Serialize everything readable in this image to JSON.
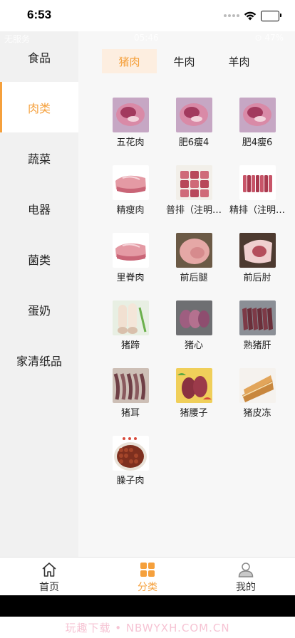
{
  "status_bar": {
    "time": "6:53"
  },
  "ghost_status": {
    "carrier": "无服务",
    "time": "05:46",
    "right": "⊙ 47%"
  },
  "colors": {
    "accent": "#f5a03c",
    "active_tab_bg": "#fdeee0",
    "sidebar_bg": "#f1f1f1",
    "content_bg": "#f7f7f7"
  },
  "sidebar": {
    "items": [
      {
        "label": "食品",
        "active": false
      },
      {
        "label": "肉类",
        "active": true
      },
      {
        "label": "蔬菜",
        "active": false
      },
      {
        "label": "电器",
        "active": false
      },
      {
        "label": "菌类",
        "active": false
      },
      {
        "label": "蛋奶",
        "active": false
      },
      {
        "label": "家清纸品",
        "active": false
      }
    ]
  },
  "subtabs": [
    {
      "label": "猪肉",
      "active": true
    },
    {
      "label": "牛肉",
      "active": false
    },
    {
      "label": "羊肉",
      "active": false
    }
  ],
  "products": [
    {
      "label": "五花肉",
      "image": "pork-belly-image"
    },
    {
      "label": "肥6瘦4",
      "image": "pork-belly-image"
    },
    {
      "label": "肥4瘦6",
      "image": "pork-belly-image"
    },
    {
      "label": "精瘦肉",
      "image": "lean-pork-image"
    },
    {
      "label": "普排（注明…",
      "image": "pork-ribs-image"
    },
    {
      "label": "精排（注明…",
      "image": "spare-ribs-image"
    },
    {
      "label": "里脊肉",
      "image": "tenderloin-image"
    },
    {
      "label": "前后腿",
      "image": "pork-leg-image"
    },
    {
      "label": "前后肘",
      "image": "pork-hock-image"
    },
    {
      "label": "猪蹄",
      "image": "pig-trotters-image"
    },
    {
      "label": "猪心",
      "image": "pig-heart-image"
    },
    {
      "label": "熟猪肝",
      "image": "pig-liver-image"
    },
    {
      "label": "猪耳",
      "image": "pig-ear-image"
    },
    {
      "label": "猪腰子",
      "image": "pig-kidney-image"
    },
    {
      "label": "猪皮冻",
      "image": "pork-jelly-image"
    },
    {
      "label": "臊子肉",
      "image": "minced-pork-image"
    }
  ],
  "tabbar": {
    "items": [
      {
        "label": "首页",
        "icon": "home-icon",
        "active": false
      },
      {
        "label": "分类",
        "icon": "category-grid-icon",
        "active": true
      },
      {
        "label": "我的",
        "icon": "profile-icon",
        "active": false
      }
    ]
  },
  "watermark": "玩趣下载 • NBWYXH.COM.CN"
}
